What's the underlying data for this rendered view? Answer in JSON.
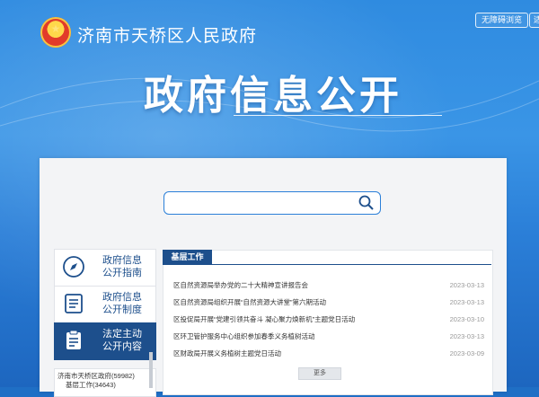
{
  "header": {
    "site_title": "济南市天桥区人民政府",
    "btn_accessible": "无障碍浏览",
    "btn_second": "适"
  },
  "hero": {
    "title": "政府信息公开"
  },
  "search": {
    "placeholder": ""
  },
  "nav": {
    "items": [
      {
        "label_line1": "政府信息",
        "label_line2": "公开指南",
        "icon": "compass-icon"
      },
      {
        "label_line1": "政府信息",
        "label_line2": "公开制度",
        "icon": "document-list-icon"
      },
      {
        "label_line1": "法定主动",
        "label_line2": "公开内容",
        "icon": "clipboard-icon"
      }
    ],
    "tree": {
      "root": "济南市天桥区政府(59982)",
      "child": "基层工作(34643)"
    }
  },
  "list": {
    "tab": "基层工作",
    "rows": [
      {
        "title": "区自然资源局举办党的二十大精神宣讲报告会",
        "date": "2023-03-13"
      },
      {
        "title": "区自然资源局组织开展“自然资源大讲堂”第六期活动",
        "date": "2023-03-13"
      },
      {
        "title": "区投促局开展“党建引领共奋斗 凝心聚力焕新机”主题党日活动",
        "date": "2023-03-10"
      },
      {
        "title": "区环卫管护服务中心组织参加春季义务植树活动",
        "date": "2023-03-13"
      },
      {
        "title": "区财政局开展义务植树主题党日活动",
        "date": "2023-03-09"
      }
    ],
    "more": "更多"
  }
}
